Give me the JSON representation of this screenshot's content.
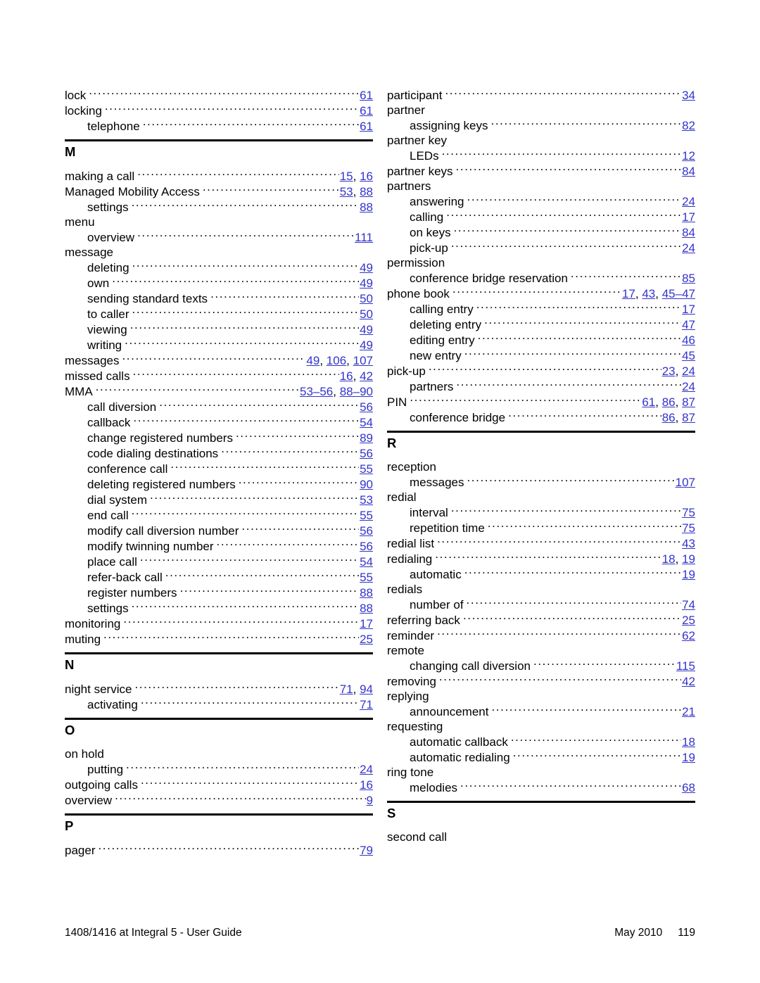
{
  "accent_color": "#3333cc",
  "rule_color": "#000000",
  "footer": {
    "left": "1408/1416 at Integral 5 - User Guide",
    "date": "May 2010",
    "page_number": "119"
  },
  "left_column": {
    "blocks": [
      {
        "type": "entries",
        "entries": [
          {
            "label": "lock",
            "level": 0,
            "pages": [
              "61"
            ]
          },
          {
            "label": "locking",
            "level": 0,
            "pages": [
              "61"
            ]
          },
          {
            "label": "telephone",
            "level": 1,
            "pages": [
              "61"
            ]
          }
        ]
      },
      {
        "type": "section",
        "letter": "M",
        "entries": [
          {
            "label": "making a call",
            "level": 0,
            "pages": [
              "15",
              "16"
            ]
          },
          {
            "label": "Managed Mobility Access",
            "level": 0,
            "pages": [
              "53",
              "88"
            ]
          },
          {
            "label": "settings",
            "level": 1,
            "pages": [
              "88"
            ]
          },
          {
            "label": "menu",
            "level": 0,
            "pages": []
          },
          {
            "label": "overview",
            "level": 1,
            "pages": [
              "111"
            ]
          },
          {
            "label": "message",
            "level": 0,
            "pages": []
          },
          {
            "label": "deleting",
            "level": 1,
            "pages": [
              "49"
            ]
          },
          {
            "label": "own",
            "level": 1,
            "pages": [
              "49"
            ]
          },
          {
            "label": "sending standard texts",
            "level": 1,
            "pages": [
              "50"
            ]
          },
          {
            "label": "to caller",
            "level": 1,
            "pages": [
              "50"
            ]
          },
          {
            "label": "viewing",
            "level": 1,
            "pages": [
              "49"
            ]
          },
          {
            "label": "writing",
            "level": 1,
            "pages": [
              "49"
            ]
          },
          {
            "label": "messages",
            "level": 0,
            "pages": [
              "49",
              "106",
              "107"
            ]
          },
          {
            "label": "missed calls",
            "level": 0,
            "pages": [
              "16",
              "42"
            ]
          },
          {
            "label": "MMA",
            "level": 0,
            "pages": [
              "53–56",
              "88–90"
            ]
          },
          {
            "label": "call diversion",
            "level": 1,
            "pages": [
              "56"
            ]
          },
          {
            "label": "callback",
            "level": 1,
            "pages": [
              "54"
            ]
          },
          {
            "label": "change registered numbers",
            "level": 1,
            "pages": [
              "89"
            ]
          },
          {
            "label": "code dialing destinations",
            "level": 1,
            "pages": [
              "56"
            ]
          },
          {
            "label": "conference call",
            "level": 1,
            "pages": [
              "55"
            ]
          },
          {
            "label": "deleting registered numbers",
            "level": 1,
            "pages": [
              "90"
            ]
          },
          {
            "label": "dial system",
            "level": 1,
            "pages": [
              "53"
            ]
          },
          {
            "label": "end call",
            "level": 1,
            "pages": [
              "55"
            ]
          },
          {
            "label": "modify call diversion number",
            "level": 1,
            "pages": [
              "56"
            ]
          },
          {
            "label": "modify twinning number",
            "level": 1,
            "pages": [
              "56"
            ]
          },
          {
            "label": "place call",
            "level": 1,
            "pages": [
              "54"
            ]
          },
          {
            "label": "refer-back call",
            "level": 1,
            "pages": [
              "55"
            ]
          },
          {
            "label": "register numbers",
            "level": 1,
            "pages": [
              "88"
            ]
          },
          {
            "label": "settings",
            "level": 1,
            "pages": [
              "88"
            ]
          },
          {
            "label": "monitoring",
            "level": 0,
            "pages": [
              "17"
            ]
          },
          {
            "label": "muting",
            "level": 0,
            "pages": [
              "25"
            ]
          }
        ]
      },
      {
        "type": "section",
        "letter": "N",
        "entries": [
          {
            "label": "night service",
            "level": 0,
            "pages": [
              "71",
              "94"
            ]
          },
          {
            "label": "activating",
            "level": 1,
            "pages": [
              "71"
            ]
          }
        ]
      },
      {
        "type": "section",
        "letter": "O",
        "entries": [
          {
            "label": "on hold",
            "level": 0,
            "pages": []
          },
          {
            "label": "putting",
            "level": 1,
            "pages": [
              "24"
            ]
          },
          {
            "label": "outgoing calls",
            "level": 0,
            "pages": [
              "16"
            ]
          },
          {
            "label": "overview",
            "level": 0,
            "pages": [
              "9"
            ]
          }
        ]
      },
      {
        "type": "section",
        "letter": "P",
        "entries": [
          {
            "label": "pager",
            "level": 0,
            "pages": [
              "79"
            ]
          }
        ]
      }
    ]
  },
  "right_column": {
    "blocks": [
      {
        "type": "entries",
        "entries": [
          {
            "label": "participant",
            "level": 0,
            "pages": [
              "34"
            ]
          },
          {
            "label": "partner",
            "level": 0,
            "pages": []
          },
          {
            "label": "assigning keys",
            "level": 1,
            "pages": [
              "82"
            ]
          },
          {
            "label": "partner key",
            "level": 0,
            "pages": []
          },
          {
            "label": "LEDs",
            "level": 1,
            "pages": [
              "12"
            ]
          },
          {
            "label": "partner keys",
            "level": 0,
            "pages": [
              "84"
            ]
          },
          {
            "label": "partners",
            "level": 0,
            "pages": []
          },
          {
            "label": "answering",
            "level": 1,
            "pages": [
              "24"
            ]
          },
          {
            "label": "calling",
            "level": 1,
            "pages": [
              "17"
            ]
          },
          {
            "label": "on keys",
            "level": 1,
            "pages": [
              "84"
            ]
          },
          {
            "label": "pick-up",
            "level": 1,
            "pages": [
              "24"
            ]
          },
          {
            "label": "permission",
            "level": 0,
            "pages": []
          },
          {
            "label": "conference bridge reservation",
            "level": 1,
            "pages": [
              "85"
            ]
          },
          {
            "label": "phone book",
            "level": 0,
            "pages": [
              "17",
              "43",
              "45–47"
            ]
          },
          {
            "label": "calling entry",
            "level": 1,
            "pages": [
              "17"
            ]
          },
          {
            "label": "deleting entry",
            "level": 1,
            "pages": [
              "47"
            ]
          },
          {
            "label": "editing entry",
            "level": 1,
            "pages": [
              "46"
            ]
          },
          {
            "label": "new entry",
            "level": 1,
            "pages": [
              "45"
            ]
          },
          {
            "label": "pick-up",
            "level": 0,
            "pages": [
              "23",
              "24"
            ]
          },
          {
            "label": "partners",
            "level": 1,
            "pages": [
              "24"
            ]
          },
          {
            "label": "PIN",
            "level": 0,
            "pages": [
              "61",
              "86",
              "87"
            ]
          },
          {
            "label": "conference bridge",
            "level": 1,
            "pages": [
              "86",
              "87"
            ]
          }
        ]
      },
      {
        "type": "section",
        "letter": "R",
        "entries": [
          {
            "label": "reception",
            "level": 0,
            "pages": []
          },
          {
            "label": "messages",
            "level": 1,
            "pages": [
              "107"
            ]
          },
          {
            "label": "redial",
            "level": 0,
            "pages": []
          },
          {
            "label": "interval",
            "level": 1,
            "pages": [
              "75"
            ]
          },
          {
            "label": "repetition time",
            "level": 1,
            "pages": [
              "75"
            ]
          },
          {
            "label": "redial list",
            "level": 0,
            "pages": [
              "43"
            ]
          },
          {
            "label": "redialing",
            "level": 0,
            "pages": [
              "18",
              "19"
            ]
          },
          {
            "label": "automatic",
            "level": 1,
            "pages": [
              "19"
            ]
          },
          {
            "label": "redials",
            "level": 0,
            "pages": []
          },
          {
            "label": "number of",
            "level": 1,
            "pages": [
              "74"
            ]
          },
          {
            "label": "referring back",
            "level": 0,
            "pages": [
              "25"
            ]
          },
          {
            "label": "reminder",
            "level": 0,
            "pages": [
              "62"
            ]
          },
          {
            "label": "remote",
            "level": 0,
            "pages": []
          },
          {
            "label": "changing call diversion",
            "level": 1,
            "pages": [
              "115"
            ]
          },
          {
            "label": "removing",
            "level": 0,
            "pages": [
              "42"
            ]
          },
          {
            "label": "replying",
            "level": 0,
            "pages": []
          },
          {
            "label": "announcement",
            "level": 1,
            "pages": [
              "21"
            ]
          },
          {
            "label": "requesting",
            "level": 0,
            "pages": []
          },
          {
            "label": "automatic callback",
            "level": 1,
            "pages": [
              "18"
            ]
          },
          {
            "label": "automatic redialing",
            "level": 1,
            "pages": [
              "19"
            ]
          },
          {
            "label": "ring tone",
            "level": 0,
            "pages": []
          },
          {
            "label": "melodies",
            "level": 1,
            "pages": [
              "68"
            ]
          }
        ]
      },
      {
        "type": "section",
        "letter": "S",
        "entries": [
          {
            "label": "second call",
            "level": 0,
            "pages": []
          }
        ]
      }
    ]
  }
}
